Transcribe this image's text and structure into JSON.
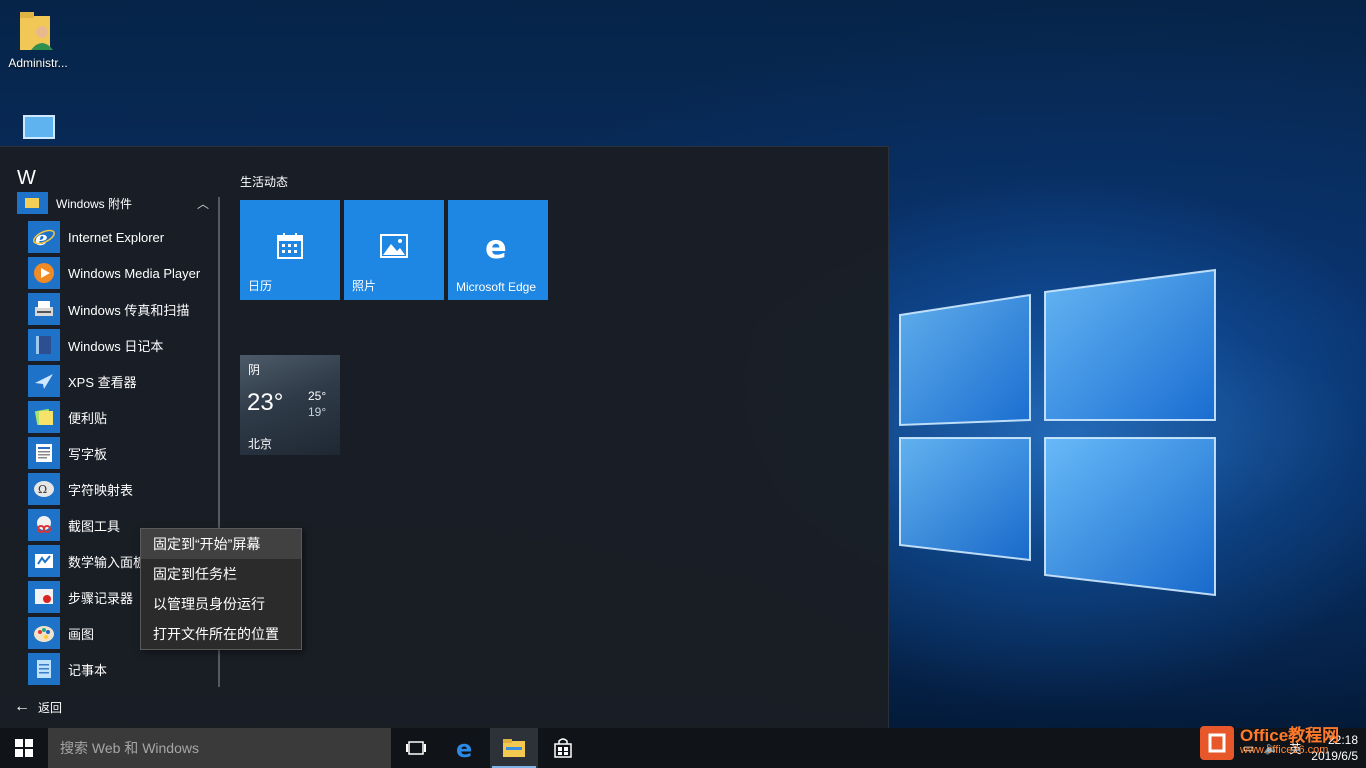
{
  "desktop": {
    "icons": [
      {
        "label": "Administr...",
        "icon": "user-folder-icon"
      },
      {
        "label": "",
        "icon": "this-pc-icon"
      }
    ]
  },
  "start_menu": {
    "letter_header": "W",
    "group": {
      "label": "Windows 附件",
      "icon": "folder-icon",
      "expanded": true
    },
    "apps": [
      {
        "label": "Internet Explorer",
        "icon": "internet-explorer-icon"
      },
      {
        "label": "Windows Media Player",
        "icon": "media-player-icon"
      },
      {
        "label": "Windows 传真和扫描",
        "icon": "fax-scan-icon"
      },
      {
        "label": "Windows 日记本",
        "icon": "journal-icon"
      },
      {
        "label": "XPS 查看器",
        "icon": "xps-viewer-icon"
      },
      {
        "label": "便利贴",
        "icon": "sticky-notes-icon"
      },
      {
        "label": "写字板",
        "icon": "wordpad-icon"
      },
      {
        "label": "字符映射表",
        "icon": "character-map-icon"
      },
      {
        "label": "截图工具",
        "icon": "snipping-tool-icon"
      },
      {
        "label": "数学输入面板",
        "icon": "math-input-icon"
      },
      {
        "label": "步骤记录器",
        "icon": "steps-recorder-icon"
      },
      {
        "label": "画图",
        "icon": "paint-icon"
      },
      {
        "label": "记事本",
        "icon": "notepad-icon"
      }
    ],
    "back_label": "返回",
    "tiles_section_title": "生活动态",
    "tiles": [
      {
        "label": "日历",
        "icon": "calendar-icon"
      },
      {
        "label": "照片",
        "icon": "photos-icon"
      },
      {
        "label": "Microsoft Edge",
        "icon": "edge-icon"
      }
    ],
    "weather": {
      "condition": "阴",
      "temperature": "23°",
      "high": "25°",
      "low": "19°",
      "city": "北京"
    }
  },
  "context_menu": {
    "items": [
      {
        "label": "固定到“开始”屏幕",
        "highlighted": true
      },
      {
        "label": "固定到任务栏",
        "highlighted": false
      },
      {
        "label": "以管理员身份运行",
        "highlighted": false
      },
      {
        "label": "打开文件所在的位置",
        "highlighted": false
      }
    ]
  },
  "taskbar": {
    "search_placeholder": "搜索 Web 和 Windows",
    "pinned": [
      {
        "name": "task-view-icon"
      },
      {
        "name": "edge-icon"
      },
      {
        "name": "file-explorer-icon",
        "active": true
      },
      {
        "name": "store-icon"
      }
    ],
    "tray": {
      "input_method": "英",
      "time": "22:18",
      "date": "2019/6/5"
    }
  },
  "watermark": {
    "line1": "Office教程网",
    "line2": "www.office26.com"
  },
  "colors": {
    "accent": "#1e86e3",
    "menu_bg": "#1a1e24",
    "taskbar_bg": "#101317"
  }
}
